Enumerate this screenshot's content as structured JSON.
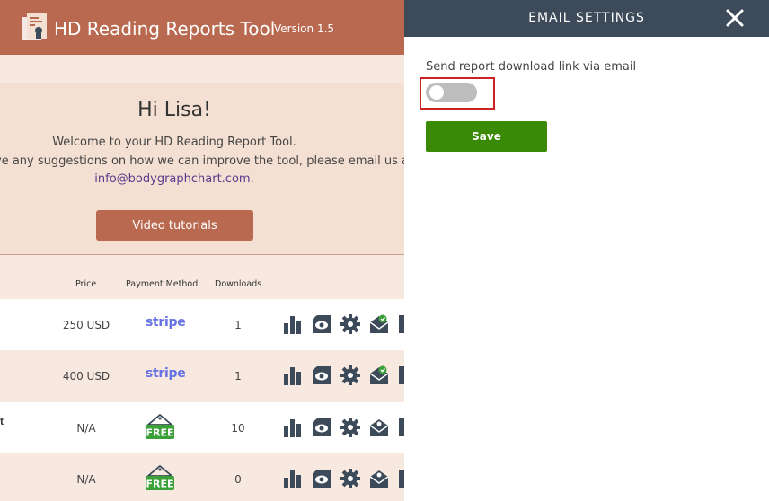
{
  "app": {
    "title": "HD Reading Reports Tool",
    "version": "Version 1.5"
  },
  "welcome": {
    "greeting": "Hi Lisa!",
    "line1": "Welcome to your HD Reading Report Tool.",
    "line2": "ve any suggestions on how we can improve the tool, please email us at",
    "email": "info@bodygraphchart.com.",
    "video_button": "Video tutorials"
  },
  "table": {
    "headers": {
      "price": "Price",
      "payment": "Payment Method",
      "downloads": "Downloads"
    },
    "rows": [
      {
        "title_fragment": "",
        "price": "250 USD",
        "payment": "stripe",
        "downloads": "1",
        "email_sent": true
      },
      {
        "title_fragment": "",
        "price": "400 USD",
        "payment": "stripe",
        "downloads": "1",
        "email_sent": true
      },
      {
        "title_fragment": "t",
        "price": "N/A",
        "payment": "FREE",
        "downloads": "10",
        "email_sent": false
      },
      {
        "title_fragment": "",
        "price": "N/A",
        "payment": "FREE",
        "downloads": "0",
        "email_sent": false
      }
    ]
  },
  "panel": {
    "title": "EMAIL SETTINGS",
    "setting_label": "Send report download link via email",
    "toggle_on": false,
    "save_label": "Save"
  },
  "colors": {
    "brand": "#b9694f",
    "panel_header": "#3c4a5a",
    "save_green": "#3a8a05",
    "highlight_red": "#cc2222"
  }
}
